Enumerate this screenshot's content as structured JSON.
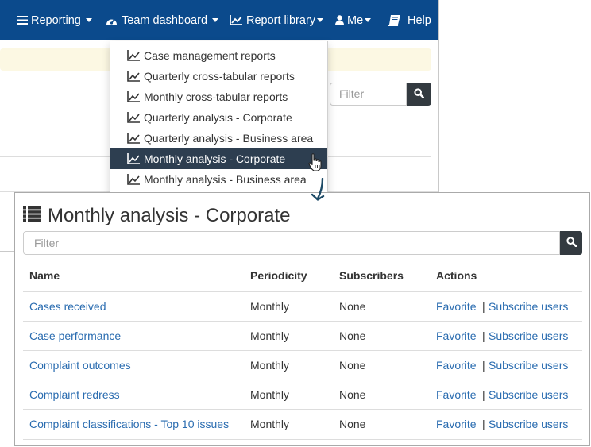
{
  "navbar": {
    "items": [
      {
        "label": "Reporting",
        "icon": "hamburger-menu-icon"
      },
      {
        "label": "Team dashboard",
        "icon": "dashboard-gauge-icon"
      },
      {
        "label": "Report library",
        "icon": "line-chart-icon"
      },
      {
        "label": "Me",
        "icon": "user-icon"
      },
      {
        "label": "Help",
        "icon": "book-icon"
      }
    ]
  },
  "background_filter": {
    "placeholder": "Filter"
  },
  "dropdown": {
    "items": [
      {
        "label": "Case management reports",
        "icon": "line-chart-icon"
      },
      {
        "label": "Quarterly cross-tabular reports",
        "icon": "line-chart-icon"
      },
      {
        "label": "Monthly cross-tabular reports",
        "icon": "line-chart-icon"
      },
      {
        "label": "Quarterly analysis - Corporate",
        "icon": "line-chart-icon"
      },
      {
        "label": "Quarterly analysis - Business area",
        "icon": "line-chart-icon"
      },
      {
        "label": "Monthly analysis - Corporate",
        "icon": "line-chart-icon",
        "active": true
      },
      {
        "label": "Monthly analysis - Business area",
        "icon": "line-chart-icon"
      }
    ]
  },
  "panel": {
    "title": "Monthly analysis - Corporate",
    "title_icon": "list-icon",
    "filter_placeholder": "Filter",
    "columns": [
      "Name",
      "Periodicity",
      "Subscribers",
      "Actions"
    ],
    "rows": [
      {
        "name": "Cases received",
        "periodicity": "Monthly",
        "subscribers": "None",
        "action_favorite": "Favorite",
        "action_separator": "|",
        "action_subscribe": "Subscribe users"
      },
      {
        "name": "Case performance",
        "periodicity": "Monthly",
        "subscribers": "None",
        "action_favorite": "Favorite",
        "action_separator": "|",
        "action_subscribe": "Subscribe users"
      },
      {
        "name": "Complaint outcomes",
        "periodicity": "Monthly",
        "subscribers": "None",
        "action_favorite": "Favorite",
        "action_separator": "|",
        "action_subscribe": "Subscribe users"
      },
      {
        "name": "Complaint redress",
        "periodicity": "Monthly",
        "subscribers": "None",
        "action_favorite": "Favorite",
        "action_separator": "|",
        "action_subscribe": "Subscribe users"
      },
      {
        "name": "Complaint classifications - Top 10 issues",
        "periodicity": "Monthly",
        "subscribers": "None",
        "action_favorite": "Favorite",
        "action_separator": "|",
        "action_subscribe": "Subscribe users"
      }
    ]
  },
  "colors": {
    "navbar_bg": "#0b4a8c",
    "menu_active_bg": "#2d3e50",
    "link": "#2a6cb0",
    "search_button": "#333a40",
    "alert_bg": "#fcf8e3"
  }
}
